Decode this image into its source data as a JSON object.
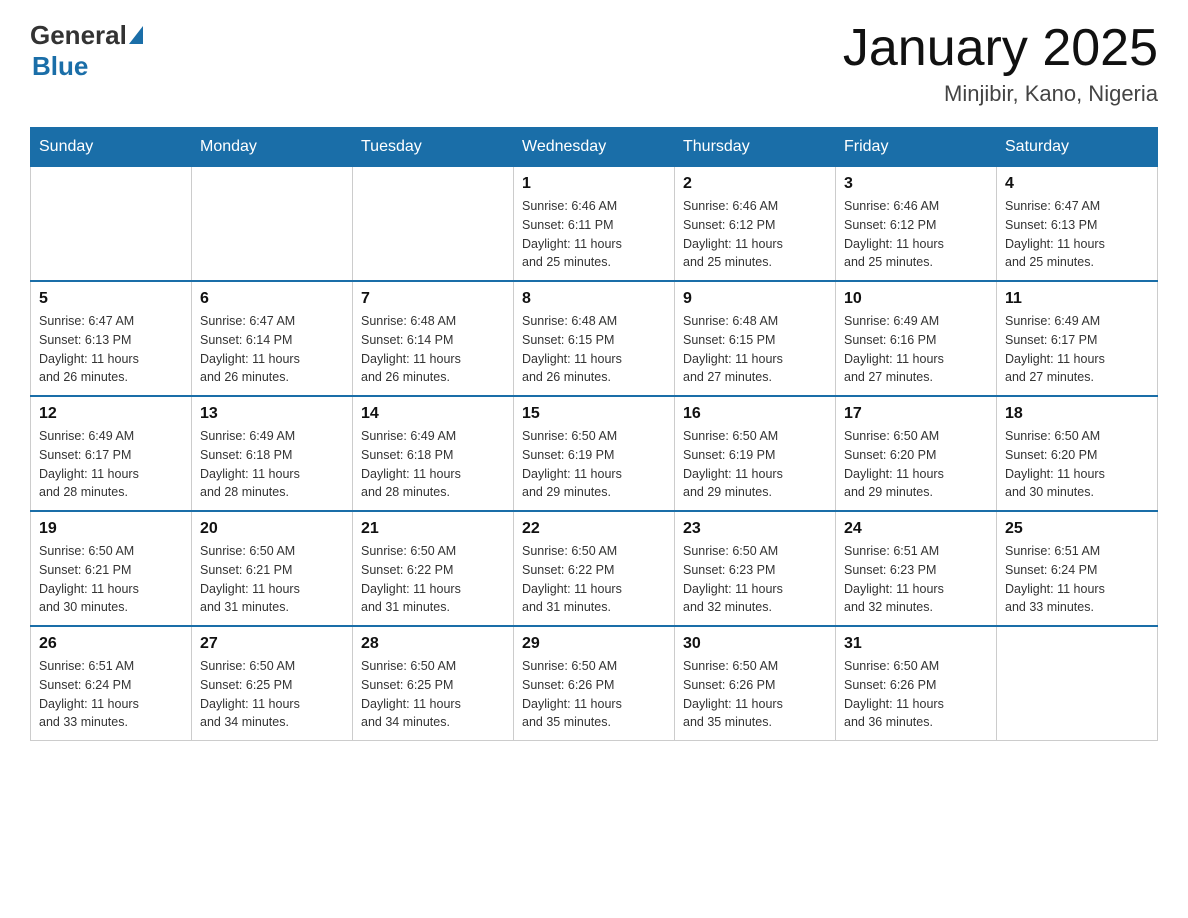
{
  "header": {
    "logo_general": "General",
    "logo_blue": "Blue",
    "month_title": "January 2025",
    "location": "Minjibir, Kano, Nigeria"
  },
  "days_of_week": [
    "Sunday",
    "Monday",
    "Tuesday",
    "Wednesday",
    "Thursday",
    "Friday",
    "Saturday"
  ],
  "weeks": [
    [
      {
        "day": "",
        "info": ""
      },
      {
        "day": "",
        "info": ""
      },
      {
        "day": "",
        "info": ""
      },
      {
        "day": "1",
        "info": "Sunrise: 6:46 AM\nSunset: 6:11 PM\nDaylight: 11 hours\nand 25 minutes."
      },
      {
        "day": "2",
        "info": "Sunrise: 6:46 AM\nSunset: 6:12 PM\nDaylight: 11 hours\nand 25 minutes."
      },
      {
        "day": "3",
        "info": "Sunrise: 6:46 AM\nSunset: 6:12 PM\nDaylight: 11 hours\nand 25 minutes."
      },
      {
        "day": "4",
        "info": "Sunrise: 6:47 AM\nSunset: 6:13 PM\nDaylight: 11 hours\nand 25 minutes."
      }
    ],
    [
      {
        "day": "5",
        "info": "Sunrise: 6:47 AM\nSunset: 6:13 PM\nDaylight: 11 hours\nand 26 minutes."
      },
      {
        "day": "6",
        "info": "Sunrise: 6:47 AM\nSunset: 6:14 PM\nDaylight: 11 hours\nand 26 minutes."
      },
      {
        "day": "7",
        "info": "Sunrise: 6:48 AM\nSunset: 6:14 PM\nDaylight: 11 hours\nand 26 minutes."
      },
      {
        "day": "8",
        "info": "Sunrise: 6:48 AM\nSunset: 6:15 PM\nDaylight: 11 hours\nand 26 minutes."
      },
      {
        "day": "9",
        "info": "Sunrise: 6:48 AM\nSunset: 6:15 PM\nDaylight: 11 hours\nand 27 minutes."
      },
      {
        "day": "10",
        "info": "Sunrise: 6:49 AM\nSunset: 6:16 PM\nDaylight: 11 hours\nand 27 minutes."
      },
      {
        "day": "11",
        "info": "Sunrise: 6:49 AM\nSunset: 6:17 PM\nDaylight: 11 hours\nand 27 minutes."
      }
    ],
    [
      {
        "day": "12",
        "info": "Sunrise: 6:49 AM\nSunset: 6:17 PM\nDaylight: 11 hours\nand 28 minutes."
      },
      {
        "day": "13",
        "info": "Sunrise: 6:49 AM\nSunset: 6:18 PM\nDaylight: 11 hours\nand 28 minutes."
      },
      {
        "day": "14",
        "info": "Sunrise: 6:49 AM\nSunset: 6:18 PM\nDaylight: 11 hours\nand 28 minutes."
      },
      {
        "day": "15",
        "info": "Sunrise: 6:50 AM\nSunset: 6:19 PM\nDaylight: 11 hours\nand 29 minutes."
      },
      {
        "day": "16",
        "info": "Sunrise: 6:50 AM\nSunset: 6:19 PM\nDaylight: 11 hours\nand 29 minutes."
      },
      {
        "day": "17",
        "info": "Sunrise: 6:50 AM\nSunset: 6:20 PM\nDaylight: 11 hours\nand 29 minutes."
      },
      {
        "day": "18",
        "info": "Sunrise: 6:50 AM\nSunset: 6:20 PM\nDaylight: 11 hours\nand 30 minutes."
      }
    ],
    [
      {
        "day": "19",
        "info": "Sunrise: 6:50 AM\nSunset: 6:21 PM\nDaylight: 11 hours\nand 30 minutes."
      },
      {
        "day": "20",
        "info": "Sunrise: 6:50 AM\nSunset: 6:21 PM\nDaylight: 11 hours\nand 31 minutes."
      },
      {
        "day": "21",
        "info": "Sunrise: 6:50 AM\nSunset: 6:22 PM\nDaylight: 11 hours\nand 31 minutes."
      },
      {
        "day": "22",
        "info": "Sunrise: 6:50 AM\nSunset: 6:22 PM\nDaylight: 11 hours\nand 31 minutes."
      },
      {
        "day": "23",
        "info": "Sunrise: 6:50 AM\nSunset: 6:23 PM\nDaylight: 11 hours\nand 32 minutes."
      },
      {
        "day": "24",
        "info": "Sunrise: 6:51 AM\nSunset: 6:23 PM\nDaylight: 11 hours\nand 32 minutes."
      },
      {
        "day": "25",
        "info": "Sunrise: 6:51 AM\nSunset: 6:24 PM\nDaylight: 11 hours\nand 33 minutes."
      }
    ],
    [
      {
        "day": "26",
        "info": "Sunrise: 6:51 AM\nSunset: 6:24 PM\nDaylight: 11 hours\nand 33 minutes."
      },
      {
        "day": "27",
        "info": "Sunrise: 6:50 AM\nSunset: 6:25 PM\nDaylight: 11 hours\nand 34 minutes."
      },
      {
        "day": "28",
        "info": "Sunrise: 6:50 AM\nSunset: 6:25 PM\nDaylight: 11 hours\nand 34 minutes."
      },
      {
        "day": "29",
        "info": "Sunrise: 6:50 AM\nSunset: 6:26 PM\nDaylight: 11 hours\nand 35 minutes."
      },
      {
        "day": "30",
        "info": "Sunrise: 6:50 AM\nSunset: 6:26 PM\nDaylight: 11 hours\nand 35 minutes."
      },
      {
        "day": "31",
        "info": "Sunrise: 6:50 AM\nSunset: 6:26 PM\nDaylight: 11 hours\nand 36 minutes."
      },
      {
        "day": "",
        "info": ""
      }
    ]
  ]
}
